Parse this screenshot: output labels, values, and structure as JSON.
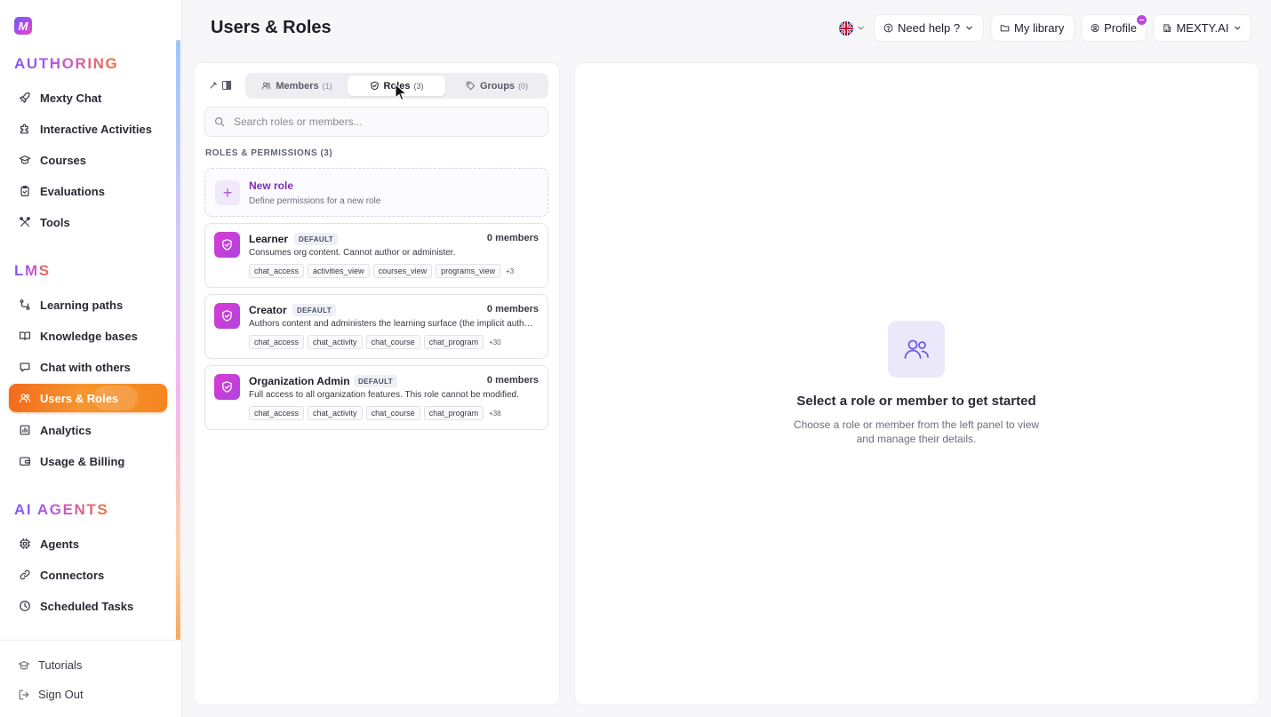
{
  "app": {
    "logo_letter": "M",
    "brand_gradient": [
      "#6d5cf6",
      "#b04ae8",
      "#ef4fa2"
    ]
  },
  "sidebar": {
    "sections": [
      {
        "title": "AUTHORING",
        "items": [
          {
            "label": "Mexty Chat",
            "icon": "rocket-icon"
          },
          {
            "label": "Interactive Activities",
            "icon": "puzzle-icon"
          },
          {
            "label": "Courses",
            "icon": "graduation-cap-icon"
          },
          {
            "label": "Evaluations",
            "icon": "clipboard-check-icon"
          },
          {
            "label": "Tools",
            "icon": "tools-icon"
          }
        ]
      },
      {
        "title": "LMS",
        "items": [
          {
            "label": "Learning paths",
            "icon": "route-icon"
          },
          {
            "label": "Knowledge bases",
            "icon": "book-icon"
          },
          {
            "label": "Chat with others",
            "icon": "chat-icon"
          },
          {
            "label": "Users & Roles",
            "icon": "users-icon",
            "active": true
          },
          {
            "label": "Analytics",
            "icon": "chart-icon"
          },
          {
            "label": "Usage & Billing",
            "icon": "wallet-icon"
          }
        ]
      },
      {
        "title": "AI AGENTS",
        "items": [
          {
            "label": "Agents",
            "icon": "cpu-icon"
          },
          {
            "label": "Connectors",
            "icon": "link-icon"
          },
          {
            "label": "Scheduled Tasks",
            "icon": "clock-icon"
          }
        ]
      }
    ],
    "footer": [
      {
        "label": "Tutorials",
        "icon": "graduation-cap-icon"
      },
      {
        "label": "Sign Out",
        "icon": "sign-out-icon"
      }
    ],
    "active_color": "#f26b1d"
  },
  "header": {
    "title": "Users & Roles",
    "language": "en-GB",
    "help_label": "Need help ?",
    "library_label": "My library",
    "profile_label": "Profile",
    "org_label": "MEXTY.AI"
  },
  "left_panel": {
    "tabs": [
      {
        "label": "Members",
        "count": "(1)",
        "icon": "users-icon"
      },
      {
        "label": "Roles",
        "count": "(3)",
        "icon": "shield-icon",
        "active": true
      },
      {
        "label": "Groups",
        "count": "(0)",
        "icon": "tag-icon"
      }
    ],
    "search_placeholder": "Search roles or members...",
    "section_label": "ROLES & PERMISSIONS (3)",
    "new_role": {
      "title": "New role",
      "subtitle": "Define permissions for a new role"
    },
    "roles": [
      {
        "name": "Learner",
        "tag": "DEFAULT",
        "members": "0 members",
        "description": "Consumes org content. Cannot author or administer.",
        "permissions": [
          "chat_access",
          "activities_view",
          "courses_view",
          "programs_view"
        ],
        "more": "+3"
      },
      {
        "name": "Creator",
        "tag": "DEFAULT",
        "members": "0 members",
        "description": "Authors content and administers the learning surface (the implicit author role).",
        "permissions": [
          "chat_access",
          "chat_activity",
          "chat_course",
          "chat_program"
        ],
        "more": "+30"
      },
      {
        "name": "Organization Admin",
        "tag": "DEFAULT",
        "members": "0 members",
        "description": "Full access to all organization features. This role cannot be modified.",
        "permissions": [
          "chat_access",
          "chat_activity",
          "chat_course",
          "chat_program"
        ],
        "more": "+38"
      }
    ],
    "role_icon_color": "#d83bd2"
  },
  "right_panel": {
    "empty_title": "Select a role or member to get started",
    "empty_subtitle": "Choose a role or member from the left panel to view and manage their details.",
    "empty_icon": "users-icon",
    "accent": "#6c5ce7"
  }
}
